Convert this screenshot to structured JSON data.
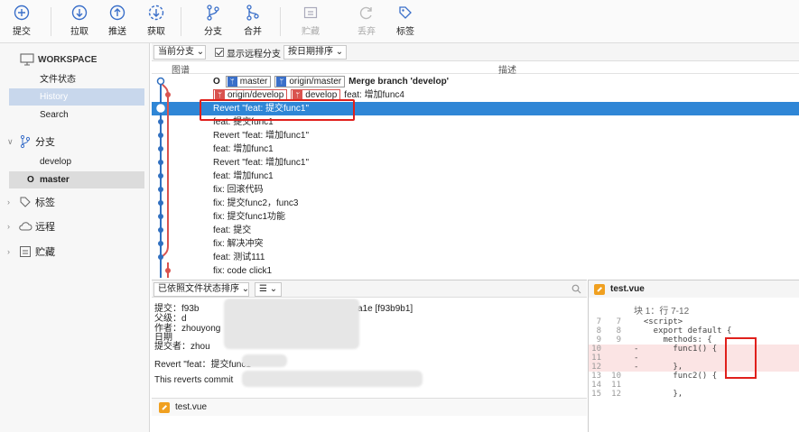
{
  "toolbar": {
    "commit": "提交",
    "pull": "拉取",
    "push": "推送",
    "fetch": "获取",
    "branch": "分支",
    "merge": "合并",
    "stash": "贮藏",
    "discard": "丢弃",
    "tag": "标签"
  },
  "sidebar": {
    "workspace": "WORKSPACE",
    "file_status": "文件状态",
    "history": "History",
    "search": "Search",
    "branches_group": "分支",
    "branches": [
      "develop",
      "master"
    ],
    "current_branch_marker": "O",
    "tags_group": "标签",
    "remotes_group": "远程",
    "stashes_group": "贮藏"
  },
  "filterbar": {
    "branch_select": "当前分支",
    "show_remote": "显示远程分支",
    "sort_select": "按日期排序"
  },
  "columns": {
    "graph": "图谱",
    "desc": "描述"
  },
  "commits": [
    {
      "msg": "Merge branch 'develop'",
      "head": "O",
      "tags": [
        "master",
        "origin/master"
      ]
    },
    {
      "msg": "feat: 增加func4",
      "tags_remote": [
        "origin/develop",
        "develop"
      ]
    },
    {
      "msg": "Revert \"feat: 提交func1\""
    },
    {
      "msg": "feat: 提交func1"
    },
    {
      "msg": "Revert \"feat: 增加func1\""
    },
    {
      "msg": "feat: 增加func1"
    },
    {
      "msg": "Revert \"feat: 增加func1\""
    },
    {
      "msg": "feat: 增加func1"
    },
    {
      "msg": "fix: 回滚代码"
    },
    {
      "msg": "fix:  提交func2，func3"
    },
    {
      "msg": "fix: 提交func1功能"
    },
    {
      "msg": "feat: 提交"
    },
    {
      "msg": "fix: 解决冲突"
    },
    {
      "msg": "feat: 测试111"
    },
    {
      "msg": "fix: code click1"
    }
  ],
  "bottom": {
    "sort_select": "已依照文件状态排序",
    "view_select": "☰",
    "commit_label": "提交：",
    "commit_hash_tail": "1a1e [f93b9b1]",
    "commit_hash_head": "f93b",
    "parent_label": "父级：",
    "parent_val": "d",
    "author_label": "作者：",
    "author_val": "zhouyong",
    "date_label": "日期",
    "committer_label": "提交者：",
    "committer_val": "zhou",
    "message": "Revert \"feat：提交func1",
    "reverts": "This reverts commit",
    "file": "test.vue"
  },
  "diff": {
    "file": "test.vue",
    "hunk": "块 1：行 7-12",
    "lines": [
      {
        "o": "7",
        "n": "7",
        "c": "  <script>",
        "t": "ctx"
      },
      {
        "o": "8",
        "n": "8",
        "c": "    export default {",
        "t": "ctx"
      },
      {
        "o": "9",
        "n": "9",
        "c": "      methods: {",
        "t": "ctx"
      },
      {
        "o": "10",
        "n": "",
        "c": "-       func1() {",
        "t": "del"
      },
      {
        "o": "11",
        "n": "",
        "c": "-",
        "t": "del"
      },
      {
        "o": "12",
        "n": "",
        "c": "-       },",
        "t": "del"
      },
      {
        "o": "13",
        "n": "10",
        "c": "        func2() {",
        "t": "ctx"
      },
      {
        "o": "14",
        "n": "11",
        "c": "",
        "t": "ctx"
      },
      {
        "o": "15",
        "n": "12",
        "c": "        },",
        "t": "ctx"
      }
    ]
  },
  "colors": {
    "accent": "#2f86d6",
    "highlight": "#e0201c",
    "graph": "#2f6fc0",
    "graph2": "#d9534f"
  }
}
